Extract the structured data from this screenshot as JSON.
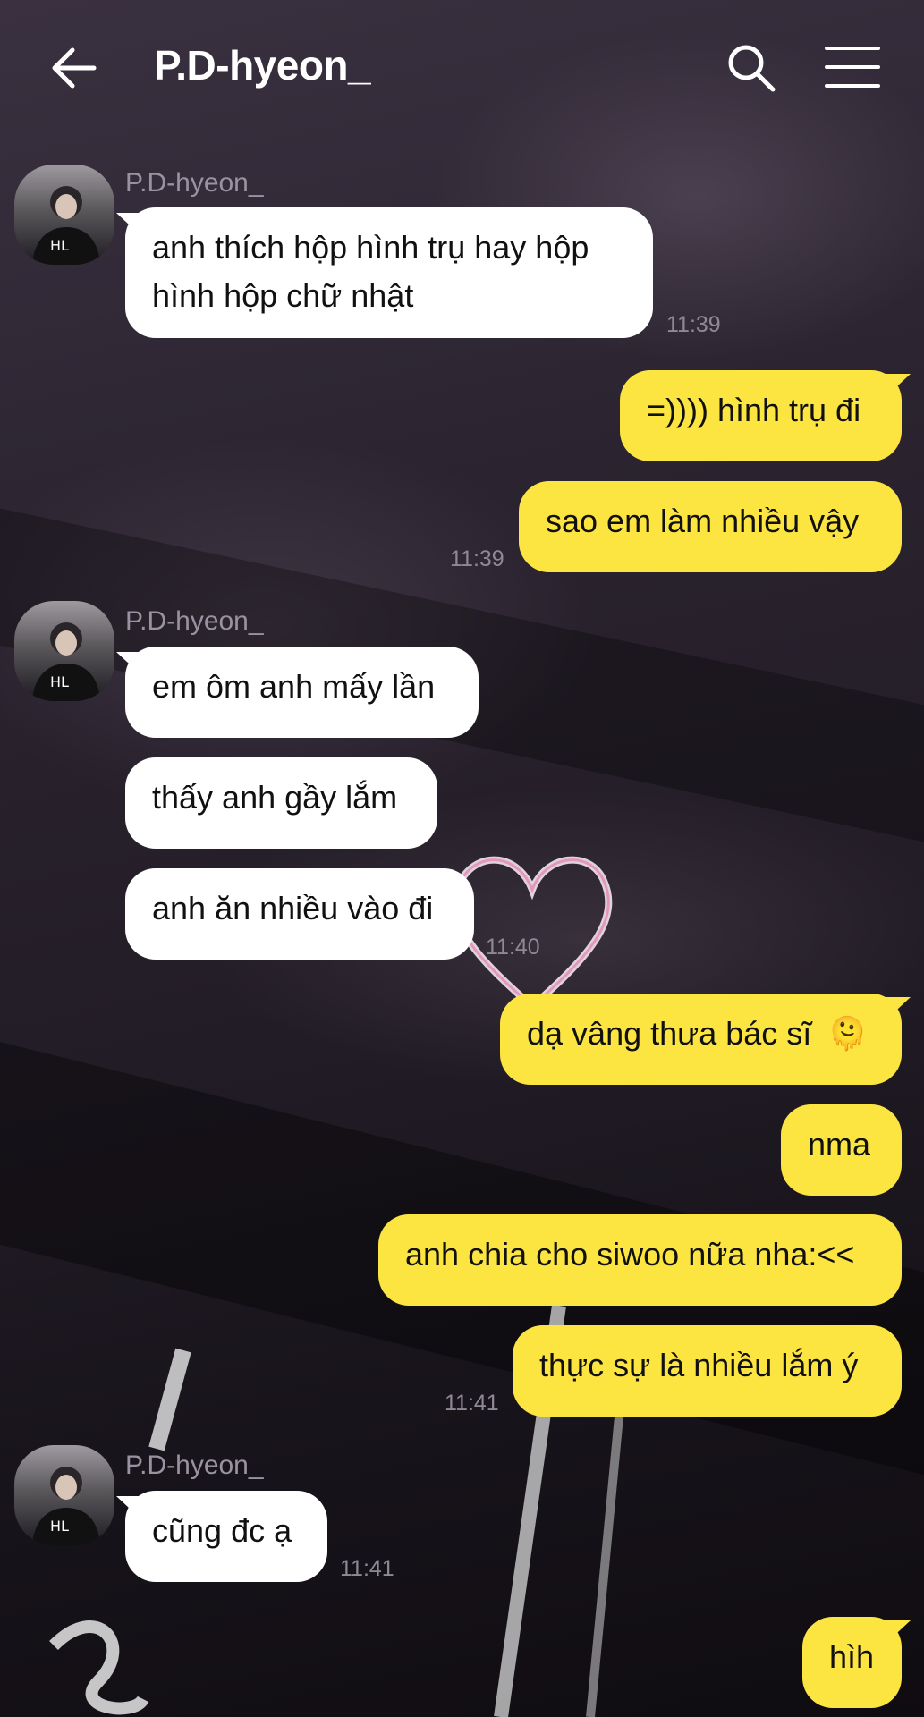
{
  "header": {
    "title": "P.D-hyeon_",
    "back_icon": "arrow-left-icon",
    "search_icon": "search-icon",
    "menu_icon": "hamburger-menu-icon"
  },
  "colors": {
    "incoming_bubble": "#ffffff",
    "outgoing_bubble": "#fde541",
    "header_text": "#ffffff",
    "timestamp": "#8f8896"
  },
  "messages": [
    {
      "sender": "P.D-hyeon_",
      "text_line1": "anh thích hộp hình trụ hay hộp",
      "text_line2": "hình hộp chữ nhật",
      "time": "11:39"
    },
    {
      "text": "=)))) hình trụ đi"
    },
    {
      "text": "sao em làm nhiều vậy",
      "time": "11:39"
    },
    {
      "sender": "P.D-hyeon_",
      "text": "em ôm anh mấy lần"
    },
    {
      "text": "thấy anh gầy lắm"
    },
    {
      "text": "anh ăn nhiều vào đi",
      "time": "11:40"
    },
    {
      "text": "dạ vâng thưa bác sĩ",
      "emoji": "🫠"
    },
    {
      "text": "nma"
    },
    {
      "text": "anh chia cho siwoo nữa nha:<<"
    },
    {
      "text": "thực sự là nhiều lắm ý",
      "time": "11:41"
    },
    {
      "sender": "P.D-hyeon_",
      "text": "cũng đc ạ",
      "time": "11:41"
    },
    {
      "text": "hìh"
    }
  ]
}
